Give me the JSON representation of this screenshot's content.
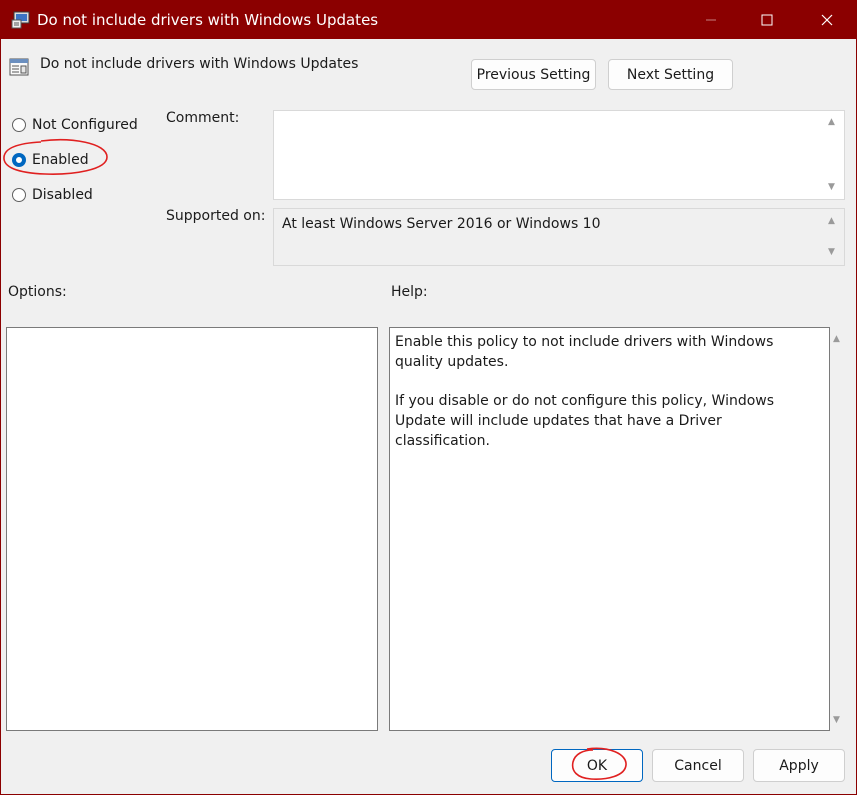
{
  "window": {
    "title": "Do not include drivers with Windows Updates",
    "title_color": "#8b0000"
  },
  "header": {
    "title": "Do not include drivers with Windows Updates",
    "previous_button": "Previous Setting",
    "next_button": "Next Setting"
  },
  "state": {
    "options": [
      {
        "label": "Not Configured",
        "checked": false
      },
      {
        "label": "Enabled",
        "checked": true
      },
      {
        "label": "Disabled",
        "checked": false
      }
    ]
  },
  "comment": {
    "label": "Comment:",
    "value": ""
  },
  "supported": {
    "label": "Supported on:",
    "value": "At least Windows Server 2016 or Windows 10"
  },
  "options_panel": {
    "label": "Options:"
  },
  "help_panel": {
    "label": "Help:",
    "paragraphs": [
      "Enable this policy to not include drivers with Windows quality updates.",
      "If you disable or do not configure this policy, Windows Update will include updates that have a Driver classification."
    ]
  },
  "footer": {
    "ok": "OK",
    "cancel": "Cancel",
    "apply": "Apply"
  },
  "icons": {
    "window_icon": "policy-window-icon",
    "setting_icon": "policy-setting-icon",
    "minimize": "minimize-icon",
    "maximize": "maximize-icon",
    "close": "close-icon"
  },
  "colors": {
    "accent": "#0067c0",
    "annotation": "#e02020"
  }
}
